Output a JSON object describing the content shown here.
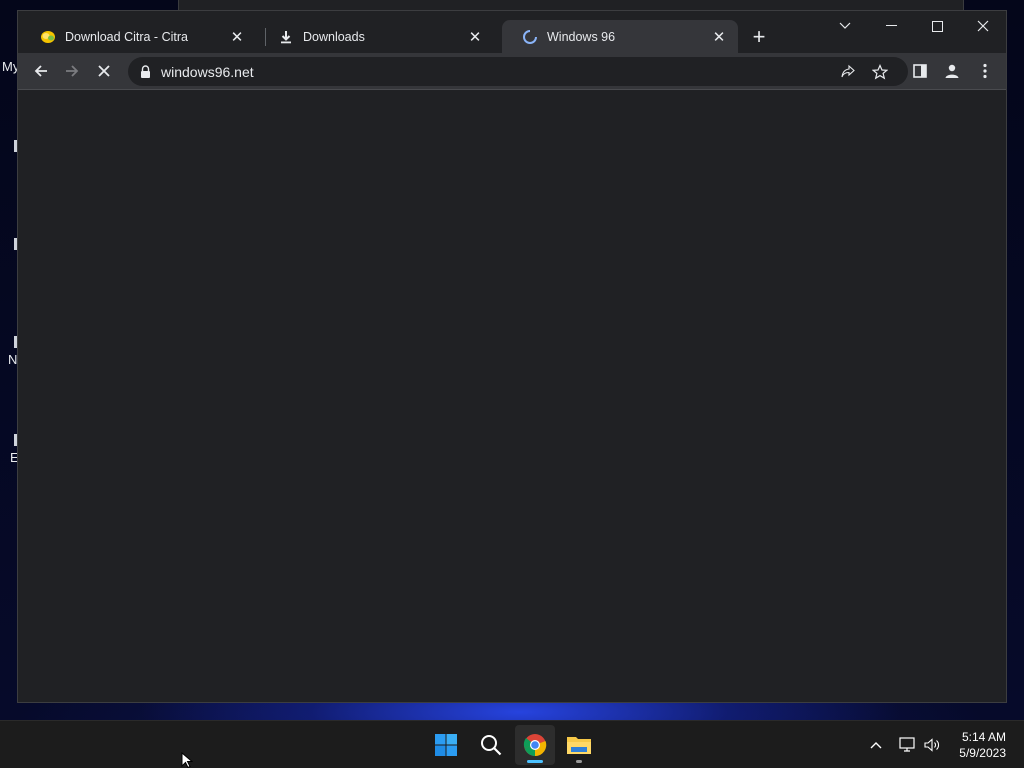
{
  "desktop": {
    "fragments": [
      "My",
      "N",
      "E"
    ]
  },
  "browser": {
    "tabs": [
      {
        "title": "Download Citra - Citra",
        "favicon": "citra-icon",
        "active": false
      },
      {
        "title": "Downloads",
        "favicon": "download-icon",
        "active": false
      },
      {
        "title": "Windows 96",
        "favicon": "loading-spinner-icon",
        "active": true
      }
    ],
    "tab_close_glyph": "✕",
    "new_tab_glyph": "+",
    "address": "windows96.net",
    "window_controls": [
      "tab-search",
      "minimize",
      "maximize",
      "close"
    ]
  },
  "taskbar": {
    "apps": [
      "start-icon",
      "search-icon",
      "chrome-icon",
      "file-explorer-icon"
    ],
    "tray": [
      "chevron-up-icon",
      "network-icon",
      "volume-icon"
    ],
    "time": "5:14 AM",
    "date": "5/9/2023"
  },
  "colors": {
    "chrome_dark": "#202124",
    "chrome_toolbar": "#35363a",
    "taskbar": "#1c1c1c",
    "accent": "#4cc2ff"
  }
}
